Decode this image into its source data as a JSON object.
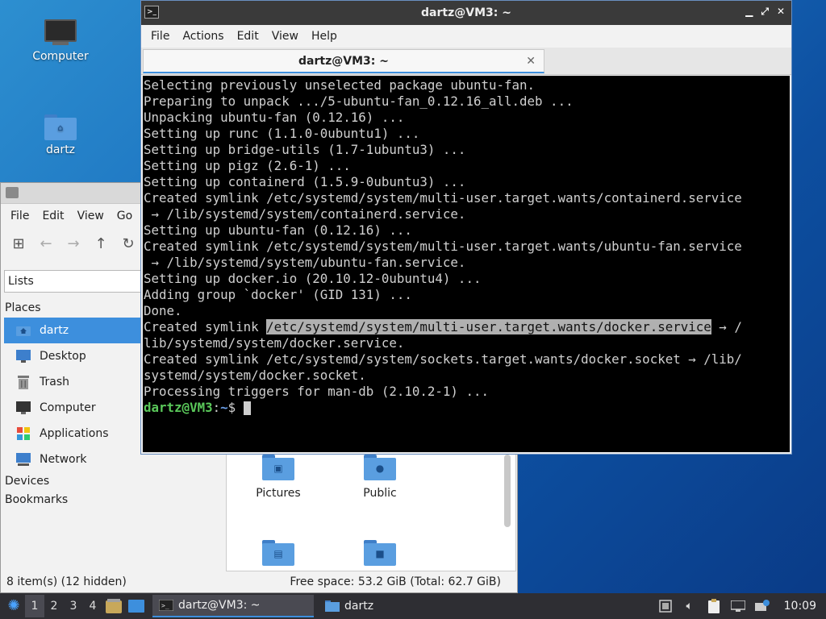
{
  "desktop": {
    "icons": [
      {
        "label": "Computer",
        "icon": "computer-icon"
      },
      {
        "label": "dartz",
        "icon": "home-folder-icon"
      }
    ]
  },
  "file_manager": {
    "menu": [
      "File",
      "Edit",
      "View",
      "Go"
    ],
    "location_mode": "Lists",
    "sidebar": {
      "places_label": "Places",
      "places": [
        {
          "label": "dartz",
          "icon": "home-icon",
          "selected": true
        },
        {
          "label": "Desktop",
          "icon": "desktop-icon",
          "selected": false
        },
        {
          "label": "Trash",
          "icon": "trash-icon",
          "selected": false
        },
        {
          "label": "Computer",
          "icon": "computer-icon",
          "selected": false
        },
        {
          "label": "Applications",
          "icon": "applications-icon",
          "selected": false
        },
        {
          "label": "Network",
          "icon": "network-icon",
          "selected": false
        }
      ],
      "devices_label": "Devices",
      "bookmarks_label": "Bookmarks"
    },
    "files": [
      {
        "label": "Pictures",
        "icon": "pictures-folder-icon"
      },
      {
        "label": "Public",
        "icon": "public-folder-icon"
      },
      {
        "label": "",
        "icon": "documents-folder-icon"
      },
      {
        "label": "",
        "icon": "videos-folder-icon"
      }
    ],
    "status_left": "8 item(s) (12 hidden)",
    "status_right": "Free space: 53.2 GiB (Total: 62.7 GiB)"
  },
  "terminal": {
    "title": "dartz@VM3: ~",
    "menu": [
      "File",
      "Actions",
      "Edit",
      "View",
      "Help"
    ],
    "tab_title": "dartz@VM3: ~",
    "lines": [
      "Selecting previously unselected package ubuntu-fan.",
      "Preparing to unpack .../5-ubuntu-fan_0.12.16_all.deb ...",
      "Unpacking ubuntu-fan (0.12.16) ...",
      "Setting up runc (1.1.0-0ubuntu1) ...",
      "Setting up bridge-utils (1.7-1ubuntu3) ...",
      "Setting up pigz (2.6-1) ...",
      "Setting up containerd (1.5.9-0ubuntu3) ...",
      "Created symlink /etc/systemd/system/multi-user.target.wants/containerd.service",
      " → /lib/systemd/system/containerd.service.",
      "Setting up ubuntu-fan (0.12.16) ...",
      "Created symlink /etc/systemd/system/multi-user.target.wants/ubuntu-fan.service",
      " → /lib/systemd/system/ubuntu-fan.service.",
      "Setting up docker.io (20.10.12-0ubuntu4) ...",
      "Adding group `docker' (GID 131) ...",
      "Done."
    ],
    "highlight_line": {
      "before": "Created symlink ",
      "selected": "/etc/systemd/system/multi-user.target.wants/docker.service",
      "after": " → /"
    },
    "lines_after": [
      "lib/systemd/system/docker.service.",
      "Created symlink /etc/systemd/system/sockets.target.wants/docker.socket → /lib/",
      "systemd/system/docker.socket.",
      "Processing triggers for man-db (2.10.2-1) ..."
    ],
    "prompt": {
      "user": "dartz@VM3",
      "sep": ":",
      "path": "~",
      "symbol": "$ "
    }
  },
  "taskbar": {
    "workspaces": [
      "1",
      "2",
      "3",
      "4"
    ],
    "active_workspace": "1",
    "tasks": [
      {
        "label": "dartz@VM3: ~",
        "icon": "terminal-icon",
        "active": true
      },
      {
        "label": "dartz",
        "icon": "folder-icon",
        "active": false
      }
    ],
    "clock": "10:09"
  },
  "colors": {
    "accent": "#3d8fdd",
    "prompt_user": "#5ac85a",
    "prompt_path": "#6a9ee8"
  }
}
